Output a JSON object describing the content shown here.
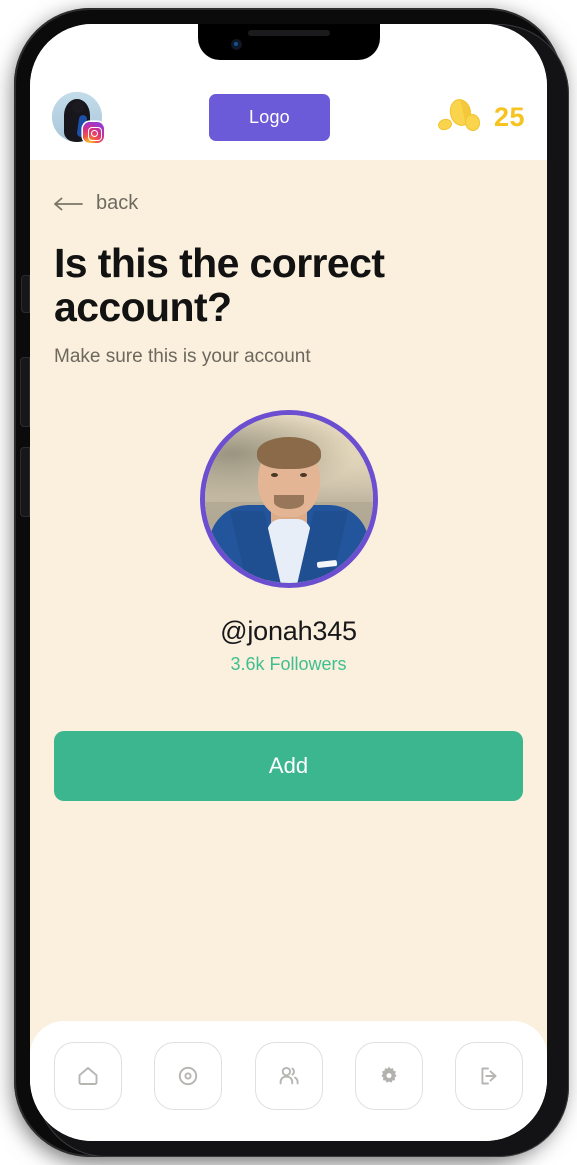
{
  "header": {
    "avatar_name": "user-avatar",
    "avatar_badge": "instagram-badge",
    "logo_label": "Logo",
    "coins_icon": "coins-icon",
    "coins_count": "25"
  },
  "nav_back": {
    "arrow": "←",
    "label": "back"
  },
  "main": {
    "title": "Is this the correct account?",
    "subtitle": "Make sure this is your account",
    "profile": {
      "photo_alt": "profile-photo",
      "handle": "@jonah345",
      "followers": "3.6k Followers"
    },
    "add_label": "Add"
  },
  "bottom_nav": {
    "items": [
      {
        "name": "home-icon",
        "label": "Home"
      },
      {
        "name": "record-icon",
        "label": "Record"
      },
      {
        "name": "people-icon",
        "label": "People"
      },
      {
        "name": "gear-icon",
        "label": "Settings"
      },
      {
        "name": "logout-icon",
        "label": "Log out"
      }
    ]
  },
  "colors": {
    "brand_purple": "#6b5bd8",
    "accent_green": "#3cb68e",
    "followers_green": "#3fbf8f",
    "coin_yellow": "#f5c421",
    "page_bg": "#faf0dd",
    "header_bg": "#ffffff",
    "ring_purple": "#6b4fd0"
  }
}
